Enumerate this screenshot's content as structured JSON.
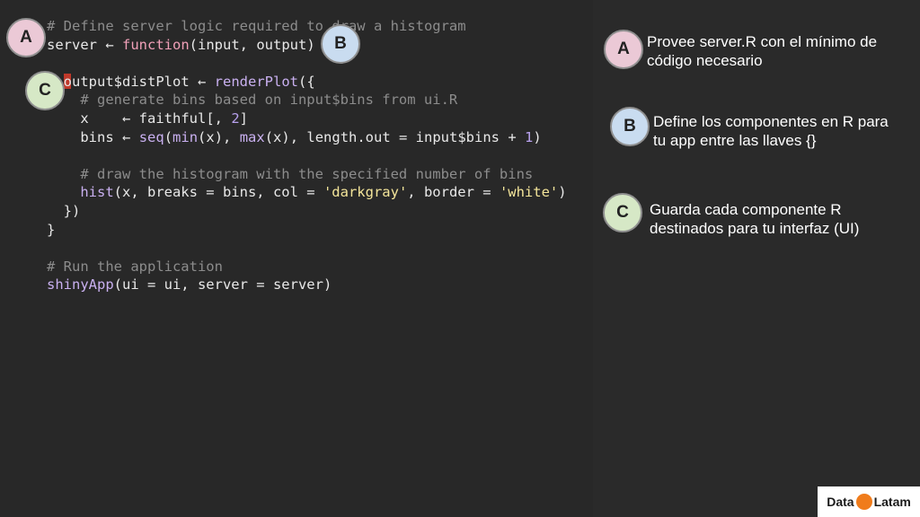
{
  "code": {
    "lines": [
      [
        {
          "t": "# Define server logic required to dr",
          "c": "comment"
        },
        {
          "t": "aw a",
          "c": "comment"
        },
        {
          "t": " histogram",
          "c": "comment"
        }
      ],
      [
        {
          "t": "server ",
          "c": "plain"
        },
        {
          "t": "←",
          "c": "plain"
        },
        {
          "t": " ",
          "c": "plain"
        },
        {
          "t": "function",
          "c": "fn"
        },
        {
          "t": "(input, output) {",
          "c": "plain"
        }
      ],
      [
        {
          "t": "",
          "c": "plain"
        }
      ],
      [
        {
          "t": "  output$distPlot ",
          "c": "plain"
        },
        {
          "t": "←",
          "c": "plain"
        },
        {
          "t": " ",
          "c": "plain"
        },
        {
          "t": "renderPlot",
          "c": "call"
        },
        {
          "t": "({",
          "c": "plain"
        }
      ],
      [
        {
          "t": "    # generate bins based on input$bins from ui.R",
          "c": "comment"
        }
      ],
      [
        {
          "t": "    x    ",
          "c": "plain"
        },
        {
          "t": "←",
          "c": "plain"
        },
        {
          "t": " faithful[, ",
          "c": "plain"
        },
        {
          "t": "2",
          "c": "num"
        },
        {
          "t": "]",
          "c": "plain"
        }
      ],
      [
        {
          "t": "    bins ",
          "c": "plain"
        },
        {
          "t": "←",
          "c": "plain"
        },
        {
          "t": " ",
          "c": "plain"
        },
        {
          "t": "seq",
          "c": "call"
        },
        {
          "t": "(",
          "c": "plain"
        },
        {
          "t": "min",
          "c": "call"
        },
        {
          "t": "(x), ",
          "c": "plain"
        },
        {
          "t": "max",
          "c": "call"
        },
        {
          "t": "(x), length.out = input$bins + ",
          "c": "plain"
        },
        {
          "t": "1",
          "c": "num"
        },
        {
          "t": ")",
          "c": "plain"
        }
      ],
      [
        {
          "t": "",
          "c": "plain"
        }
      ],
      [
        {
          "t": "    # draw the histogram with the specified number of bins",
          "c": "comment"
        }
      ],
      [
        {
          "t": "    ",
          "c": "plain"
        },
        {
          "t": "hist",
          "c": "call"
        },
        {
          "t": "(x, breaks = bins, col = ",
          "c": "plain"
        },
        {
          "t": "'darkgray'",
          "c": "str"
        },
        {
          "t": ", border = ",
          "c": "plain"
        },
        {
          "t": "'white'",
          "c": "str"
        },
        {
          "t": ")",
          "c": "plain"
        }
      ],
      [
        {
          "t": "  })",
          "c": "plain"
        }
      ],
      [
        {
          "t": "}",
          "c": "plain"
        }
      ],
      [
        {
          "t": "",
          "c": "plain"
        }
      ],
      [
        {
          "t": "# Run the application",
          "c": "comment"
        }
      ],
      [
        {
          "t": "shinyApp",
          "c": "call"
        },
        {
          "t": "(ui = ui, server = server)",
          "c": "plain"
        }
      ]
    ]
  },
  "badges": {
    "code_a": "A",
    "code_b": "B",
    "code_c": "C",
    "note_a": "A",
    "note_b": "B",
    "note_c": "C"
  },
  "notes": {
    "a": [
      "Provee server.R con el mínimo de",
      "código necesario"
    ],
    "b": [
      "Define los componentes en R para",
      "tu app entre las llaves {}"
    ],
    "c": [
      "Guarda cada componente R",
      "destinados para tu interfaz (UI)"
    ]
  },
  "logo": {
    "left": "Data",
    "right": "Latam",
    "mark_icon": "flame-icon"
  },
  "colors": {
    "background": "#282828",
    "badge_a": "#ebc9d6",
    "badge_b": "#c9dcf0",
    "badge_c": "#d6e8c6",
    "comment": "#8c8c8c",
    "function_keyword": "#f0a0b8",
    "call": "#c9b0f0",
    "string": "#f4e59a"
  }
}
